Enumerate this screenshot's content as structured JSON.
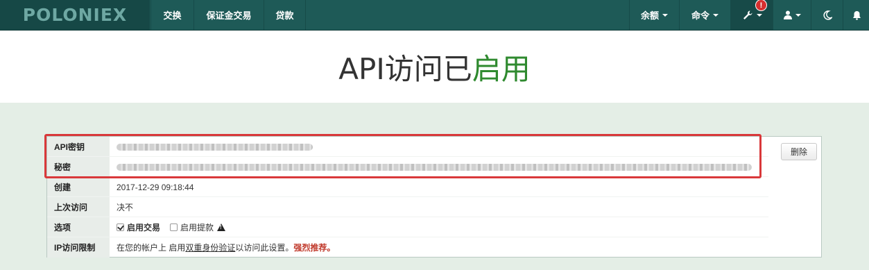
{
  "navbar": {
    "logo": "POLONIEX",
    "items": [
      {
        "label": "交换"
      },
      {
        "label": "保证金交易"
      },
      {
        "label": "贷款"
      }
    ],
    "right": {
      "balance": "余额",
      "orders": "命令",
      "alert_count": "!"
    }
  },
  "title": {
    "prefix": "API访问已",
    "status": "启用",
    "status_color": "#2f8a2f"
  },
  "panel": {
    "delete_label": "删除",
    "rows": {
      "api_key": {
        "label": "API密钥"
      },
      "secret": {
        "label": "秘密"
      },
      "created": {
        "label": "创建",
        "value": "2017-12-29 09:18:44"
      },
      "last_access": {
        "label": "上次访问",
        "value": "决不"
      },
      "options": {
        "label": "选项",
        "enable_trading": "启用交易",
        "enable_trading_checked": true,
        "enable_withdrawals": "启用提款",
        "enable_withdrawals_checked": false
      },
      "ip_restriction": {
        "label": "IP访问限制",
        "text_before": "在您的帐户上 启用",
        "link": "双重身份验证",
        "text_after": "以访问此设置。",
        "strong": "强烈推荐。"
      }
    }
  },
  "colors": {
    "navbar": "#1e5a57",
    "highlight": "#d9383a",
    "page_bg": "#e4eee6"
  }
}
